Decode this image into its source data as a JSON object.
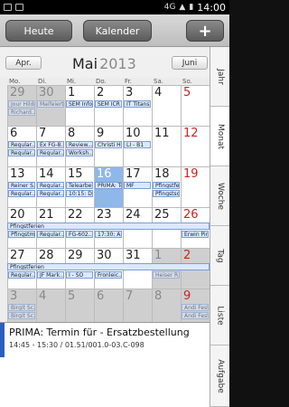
{
  "status": {
    "net": "4G",
    "time": "14:00"
  },
  "toolbar": {
    "today": "Heute",
    "calendar": "Kalender",
    "add": "+"
  },
  "header": {
    "prev": "Apr.",
    "month": "Mai",
    "year": "2013",
    "next": "Juni"
  },
  "weekdays": [
    "Mo.",
    "Di.",
    "Mi.",
    "Do.",
    "Fr.",
    "Sa.",
    "So."
  ],
  "tabs": [
    "Jahr",
    "Monat",
    "Woche",
    "Tag",
    "Liste",
    "Aufgabe"
  ],
  "weeks": [
    {
      "days": [
        {
          "n": "29",
          "off": true
        },
        {
          "n": "30",
          "off": true
        },
        {
          "n": "1"
        },
        {
          "n": "2"
        },
        {
          "n": "3"
        },
        {
          "n": "4"
        },
        {
          "n": "5",
          "sun": true
        }
      ],
      "events": [
        [
          "Jour Hilde...",
          "Maifeiert...",
          "SEM Info PAT etc.",
          "SEM ICR RS H.S...",
          "IT Titans Meeting"
        ],
        [
          "Richard...",
          ""
        ]
      ]
    },
    {
      "days": [
        {
          "n": "6"
        },
        {
          "n": "7"
        },
        {
          "n": "8"
        },
        {
          "n": "9"
        },
        {
          "n": "10"
        },
        {
          "n": "11"
        },
        {
          "n": "12",
          "sun": true
        }
      ],
      "events": [
        [
          "Regular...",
          "Ex FG-8...",
          "Review...",
          "Christi Hi mmelfahrt",
          "LI - B1"
        ],
        [
          "Regular...",
          "Regular...",
          "Worksh..."
        ]
      ]
    },
    {
      "days": [
        {
          "n": "13"
        },
        {
          "n": "14"
        },
        {
          "n": "15"
        },
        {
          "n": "16",
          "today": true
        },
        {
          "n": "17"
        },
        {
          "n": "18"
        },
        {
          "n": "19",
          "sun": true
        }
      ],
      "events": [
        [
          "Reiner S...",
          "Regular...",
          "Telearbeit",
          "PRIMA: Termin...",
          "MF",
          "Pfingstferien"
        ],
        [
          "Regular...",
          "Regular...",
          "10:15: D...",
          "",
          "",
          "Pfingstso..."
        ]
      ]
    },
    {
      "days": [
        {
          "n": "20"
        },
        {
          "n": "21"
        },
        {
          "n": "22"
        },
        {
          "n": "23"
        },
        {
          "n": "24"
        },
        {
          "n": "25"
        },
        {
          "n": "26",
          "sun": true
        }
      ],
      "band": "Pfingstferien",
      "events": [
        [
          "Pfingstm...",
          "Regular...",
          "FG-602...",
          "17:30: A...",
          "",
          "",
          "Erwin Pin..."
        ]
      ]
    },
    {
      "days": [
        {
          "n": "27"
        },
        {
          "n": "28"
        },
        {
          "n": "29"
        },
        {
          "n": "30"
        },
        {
          "n": "31"
        },
        {
          "n": "1",
          "off": true
        },
        {
          "n": "2",
          "off": true,
          "sun": true
        }
      ],
      "band": "Pfingstferien",
      "events": [
        [
          "Regular...",
          "JF Mark...",
          "I - SO",
          "Fronleic...",
          "",
          "Heiser R..."
        ]
      ]
    },
    {
      "days": [
        {
          "n": "3",
          "off": true
        },
        {
          "n": "4",
          "off": true
        },
        {
          "n": "5",
          "off": true
        },
        {
          "n": "6",
          "off": true
        },
        {
          "n": "7",
          "off": true
        },
        {
          "n": "8",
          "off": true
        },
        {
          "n": "9",
          "off": true,
          "sun": true
        }
      ],
      "events": [
        [
          "Birgit Sc...",
          "",
          "",
          "",
          "",
          "",
          "Andi Fest..."
        ],
        [
          "Birgit Sc...",
          "",
          "",
          "",
          "",
          "",
          "Andi Fest..."
        ]
      ]
    }
  ],
  "detail": {
    "title": "PRIMA: Termin für - Ersatzbestellung",
    "time": "14:45 - 15:30 / 01.51/001.0-03.C-098"
  },
  "colors": {
    "accent": "#2a5fbf",
    "today": "#8fb7ea",
    "event": "#dce8fb"
  }
}
